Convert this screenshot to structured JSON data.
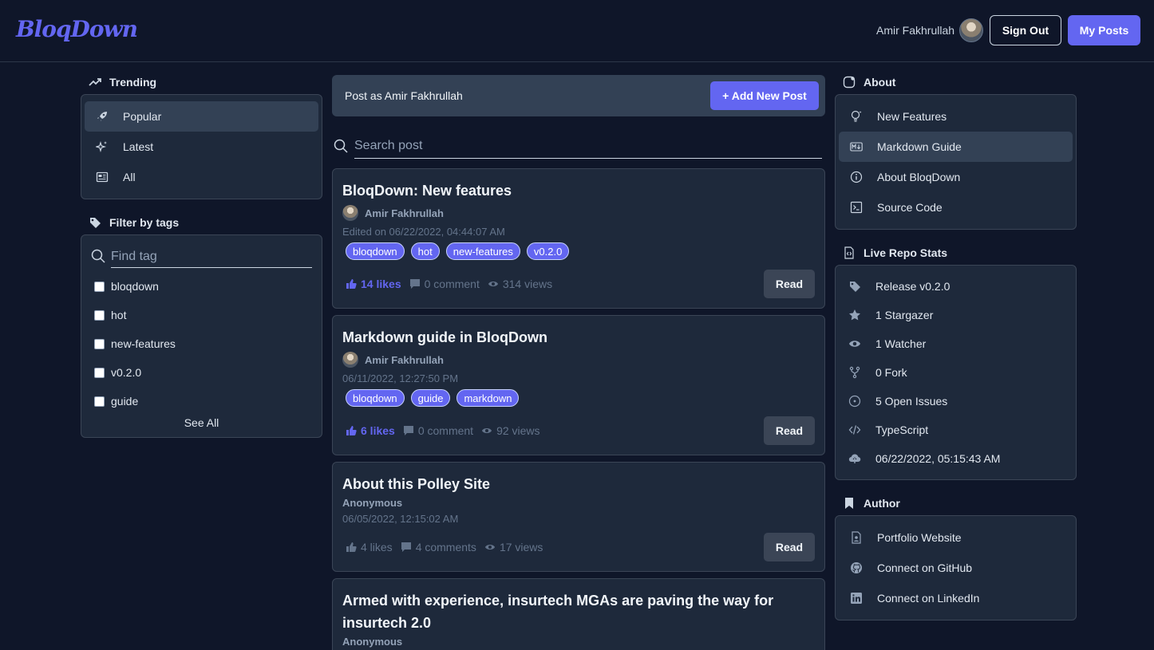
{
  "app": {
    "logo": "BloqDown"
  },
  "header": {
    "user_name": "Amir Fakhrullah",
    "sign_out_label": "Sign Out",
    "my_posts_label": "My Posts"
  },
  "trending": {
    "title": "Trending",
    "items": [
      {
        "label": "Popular",
        "icon": "rocket-icon",
        "active": true
      },
      {
        "label": "Latest",
        "icon": "sparkles-icon",
        "active": false
      },
      {
        "label": "All",
        "icon": "newspaper-icon",
        "active": false
      }
    ]
  },
  "tags_filter": {
    "title": "Filter by tags",
    "placeholder": "Find tag",
    "tags": [
      "bloqdown",
      "hot",
      "new-features",
      "v0.2.0",
      "guide"
    ],
    "see_all_label": "See All"
  },
  "composer": {
    "post_as_text": "Post as Amir Fakhrullah",
    "add_label": "+ Add New Post",
    "search_placeholder": "Search post"
  },
  "posts": [
    {
      "title": "BloqDown: New features",
      "author": "Amir Fakhrullah",
      "date": "Edited on 06/22/2022, 04:44:07 AM",
      "tags": [
        "bloqdown",
        "hot",
        "new-features",
        "v0.2.0"
      ],
      "likes": "14 likes",
      "comments": "0 comment",
      "views": "314 views",
      "read_label": "Read"
    },
    {
      "title": "Markdown guide in BloqDown",
      "author": "Amir Fakhrullah",
      "date": "06/11/2022, 12:27:50 PM",
      "tags": [
        "bloqdown",
        "guide",
        "markdown"
      ],
      "likes": "6 likes",
      "comments": "0 comment",
      "views": "92 views",
      "read_label": "Read"
    },
    {
      "title": "About this Polley Site",
      "author": "Anonymous",
      "date": "06/05/2022, 12:15:02 AM",
      "tags": [],
      "likes": "4 likes",
      "comments": "4 comments",
      "views": "17 views",
      "read_label": "Read"
    },
    {
      "title": "Armed with experience, insurtech MGAs are paving the way for insurtech 2.0",
      "author": "Anonymous"
    }
  ],
  "about": {
    "title": "About",
    "items": [
      {
        "label": "New Features",
        "icon": "lightbulb-icon",
        "active": false
      },
      {
        "label": "Markdown Guide",
        "icon": "markdown-icon",
        "active": true
      },
      {
        "label": "About BloqDown",
        "icon": "info-icon",
        "active": false
      },
      {
        "label": "Source Code",
        "icon": "terminal-icon",
        "active": false
      }
    ]
  },
  "repo_stats": {
    "title": "Live Repo Stats",
    "items": [
      {
        "label": "Release v0.2.0",
        "icon": "tag-icon"
      },
      {
        "label": "1 Stargazer",
        "icon": "star-icon"
      },
      {
        "label": "1 Watcher",
        "icon": "eye-icon"
      },
      {
        "label": "0 Fork",
        "icon": "fork-icon"
      },
      {
        "label": "5 Open Issues",
        "icon": "issue-icon"
      },
      {
        "label": "TypeScript",
        "icon": "code-icon"
      },
      {
        "label": "06/22/2022, 05:15:43 AM",
        "icon": "cloud-upload-icon"
      }
    ]
  },
  "author_section": {
    "title": "Author",
    "items": [
      {
        "label": "Portfolio Website",
        "icon": "portfolio-icon"
      },
      {
        "label": "Connect on GitHub",
        "icon": "github-icon"
      },
      {
        "label": "Connect on LinkedIn",
        "icon": "linkedin-icon"
      }
    ]
  },
  "colors": {
    "accent": "#6366f1",
    "background": "#0f1629",
    "card": "#1e293b"
  }
}
